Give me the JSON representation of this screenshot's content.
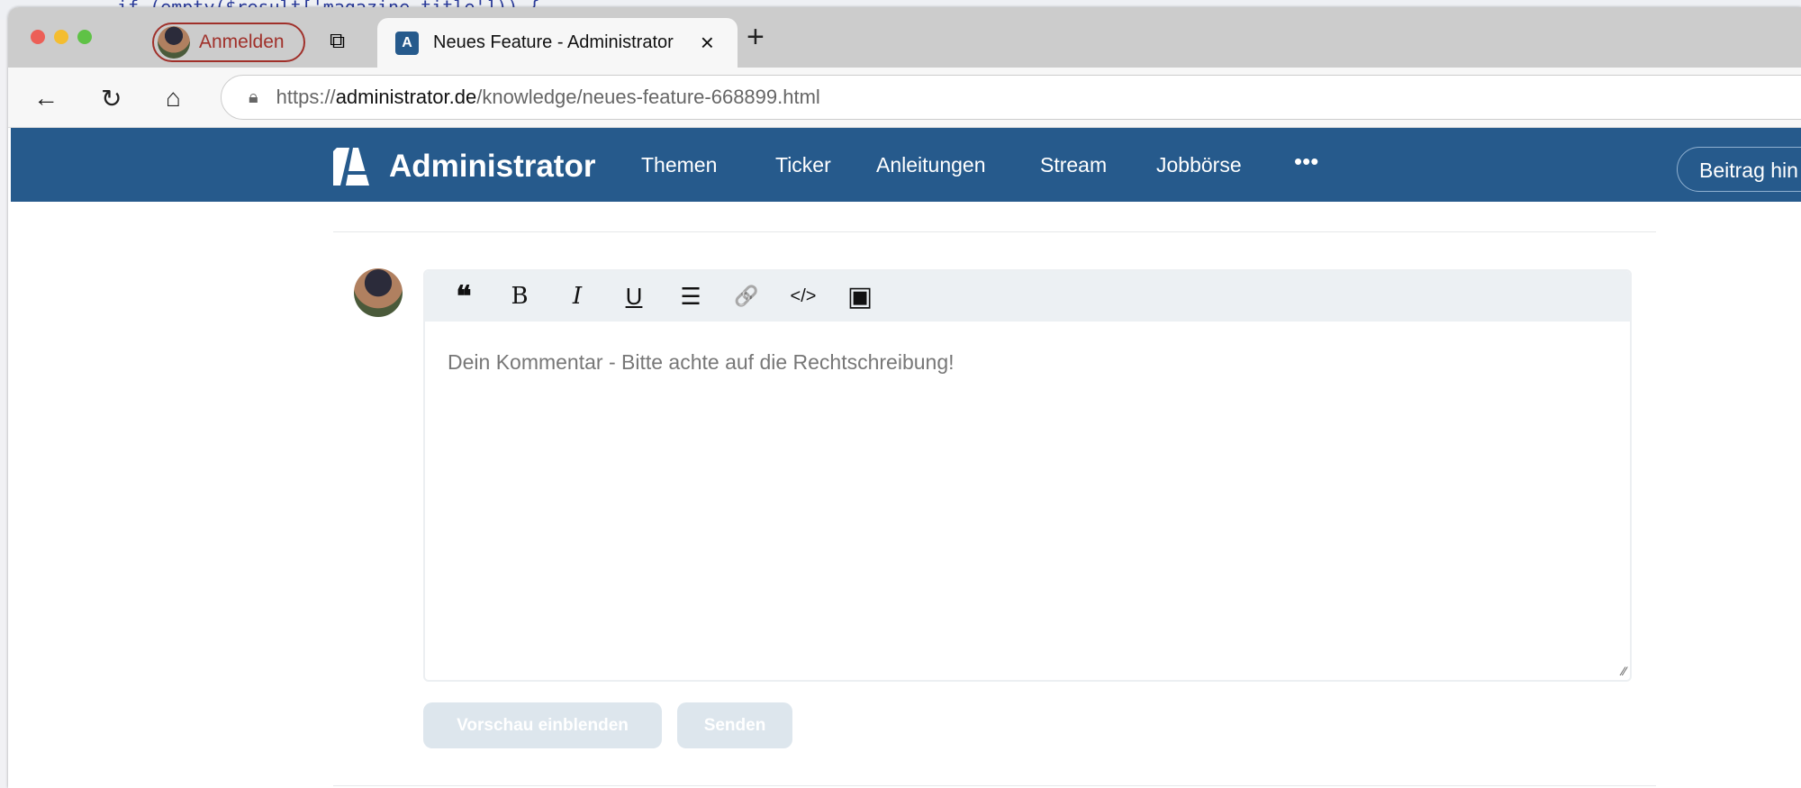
{
  "background_code": "if (empty($result['magazine_title'])) {",
  "browser": {
    "profile_label": "Anmelden",
    "tab_title": "Neues Feature - Administrator",
    "tab_close": "×",
    "new_tab": "+",
    "url_scheme": "https://",
    "url_host": "administrator.de",
    "url_path": "/knowledge/neues-feature-668899.html"
  },
  "site_nav": {
    "brand": "Administrator",
    "items": [
      "Themen",
      "Ticker",
      "Anleitungen",
      "Stream",
      "Jobbörse"
    ],
    "more": "•••",
    "cta": "Beitrag hin",
    "color": "#265a8c"
  },
  "comment": {
    "toolbar": [
      {
        "icon": "quote-icon",
        "glyph": "❝"
      },
      {
        "icon": "bold-icon",
        "glyph": "B"
      },
      {
        "icon": "italic-icon",
        "glyph": "I"
      },
      {
        "icon": "underline-icon",
        "glyph": "U"
      },
      {
        "icon": "list-icon",
        "glyph": "☰"
      },
      {
        "icon": "link-icon",
        "glyph": "🔗"
      },
      {
        "icon": "code-icon",
        "glyph": "</>"
      },
      {
        "icon": "image-icon",
        "glyph": "▣"
      }
    ],
    "placeholder": "Dein Kommentar - Bitte achte auf die Rechtschreibung!",
    "preview_button": "Vorschau einblenden",
    "send_button": "Senden"
  }
}
